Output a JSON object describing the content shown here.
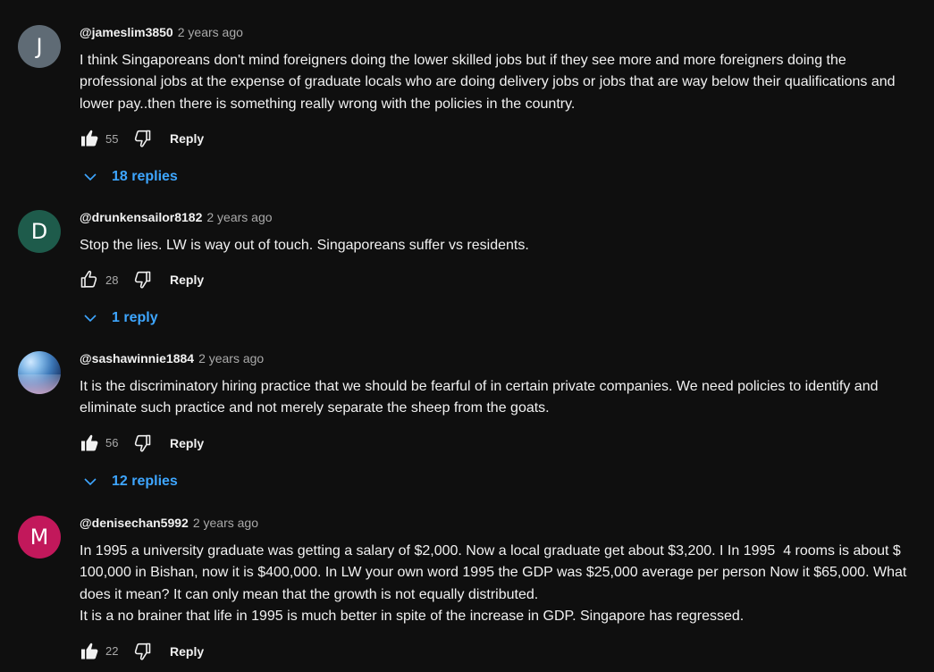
{
  "colors": {
    "background": "#0f0f0f",
    "link_blue": "#3ea6ff",
    "avatar_j": "#5f6b75",
    "avatar_d": "#1e5b4b",
    "avatar_m": "#c2185b"
  },
  "comments": [
    {
      "avatar_letter": "J",
      "author": "@jameslim3850",
      "time": "2 years ago",
      "text": "I think Singaporeans don't mind foreigners doing the lower skilled jobs but if they see more and more foreigners doing the professional jobs at the expense of graduate locals who are doing delivery jobs or jobs that are way below their qualifications and lower pay..then there is something really wrong with the policies in the country.",
      "likes": "55",
      "liked": true,
      "reply_label": "Reply",
      "replies_label": "18 replies"
    },
    {
      "avatar_letter": "D",
      "author": "@drunkensailor8182",
      "time": "2 years ago",
      "text": "Stop the lies. LW is way out of touch. Singaporeans suffer vs residents.",
      "likes": "28",
      "liked": false,
      "reply_label": "Reply",
      "replies_label": "1 reply"
    },
    {
      "avatar_letter": "",
      "author": "@sashawinnie1884",
      "time": "2 years ago",
      "text": "It is the discriminatory hiring practice that we should be fearful of in certain private companies. We need policies to identify and eliminate such practice and not merely separate the sheep from the goats.",
      "likes": "56",
      "liked": true,
      "reply_label": "Reply",
      "replies_label": "12 replies"
    },
    {
      "avatar_letter": "M",
      "author": "@denisechan5992",
      "time": "2 years ago",
      "text": "In 1995 a university graduate was getting a salary of $2,000. Now a local graduate get about $3,200. I In 1995  4 rooms is about $ 100,000 in Bishan, now it is $400,000. In LW your own word 1995 the GDP was $25,000 average per person Now it $65,000. What does it mean? It can only mean that the growth is not equally distributed.\nIt is a no brainer that life in 1995 is much better in spite of the increase in GDP. Singapore has regressed.",
      "likes": "22",
      "liked": true,
      "reply_label": "Reply",
      "replies_label": ""
    }
  ]
}
